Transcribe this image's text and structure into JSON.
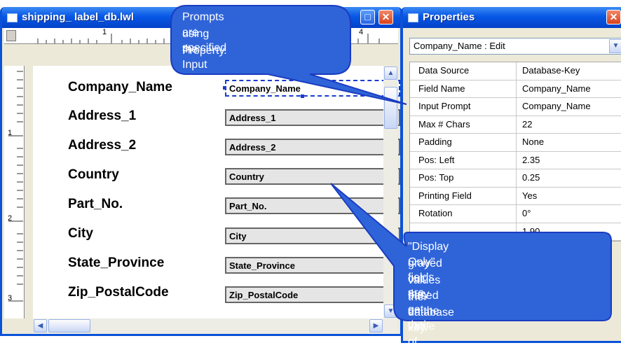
{
  "layout_window": {
    "title": "shipping_ label_db.lwl",
    "ruler_marks": [
      "1",
      "4"
    ],
    "vruler_marks": [
      "1",
      "2",
      "3"
    ],
    "fields": [
      {
        "label": "Company_Name",
        "value": "Company_Name",
        "selected": true
      },
      {
        "label": "Address_1",
        "value": "Address_1"
      },
      {
        "label": "Address_2",
        "value": "Address_2"
      },
      {
        "label": "Country",
        "value": "Country"
      },
      {
        "label": "Part_No.",
        "value": "Part_No."
      },
      {
        "label": "City",
        "value": "City"
      },
      {
        "label": "State_Province",
        "value": "State_Province"
      },
      {
        "label": "Zip_PostalCode",
        "value": "Zip_PostalCode"
      }
    ]
  },
  "properties_window": {
    "title": "Properties",
    "object_selector": "Company_Name : Edit",
    "rows": [
      {
        "name": "Data Source",
        "value": "Database-Key"
      },
      {
        "name": "Field Name",
        "value": "Company_Name"
      },
      {
        "name": "Input Prompt",
        "value": "Company_Name"
      },
      {
        "name": "Max # Chars",
        "value": "22"
      },
      {
        "name": "Padding",
        "value": "None"
      },
      {
        "name": "Pos: Left",
        "value": "2.35"
      },
      {
        "name": "Pos: Top",
        "value": "0.25"
      },
      {
        "name": "Printing Field",
        "value": "Yes"
      },
      {
        "name": "Rotation",
        "value": "0°"
      },
      {
        "name": "",
        "value": "1.90"
      }
    ]
  },
  "callouts": {
    "top": [
      "Prompts are specified",
      "using the Input Prompt",
      "Property."
    ],
    "bottom": [
      "\"Display Only\" fields are",
      "grayed out; they get their",
      "values based on the value of",
      "the database key."
    ]
  },
  "colors": {
    "title_blue": "#0757e6",
    "callout_fill": "#ffffff",
    "callout_stroke": "#1a3cc0",
    "display_only_fill": "#e5e5e5"
  }
}
